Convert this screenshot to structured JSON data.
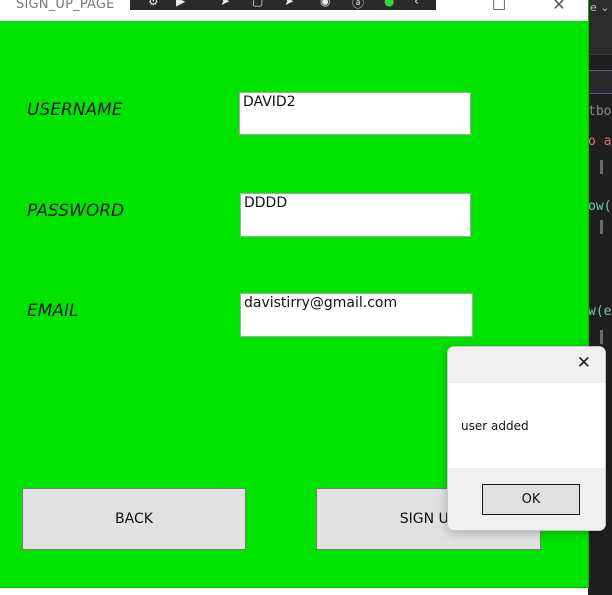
{
  "window": {
    "title": "SIGN_UP_PAGE",
    "minimize_glyph": "—",
    "maximize_glyph": "☐",
    "close_glyph": "✕",
    "background_color": "#00e400"
  },
  "form": {
    "username_label": "USERNAME",
    "username_value": "DAVID2",
    "password_label": "PASSWORD",
    "password_value": "DDDD",
    "email_label": "EMAIL",
    "email_value": "davistirry@gmail.com"
  },
  "buttons": {
    "back": "BACK",
    "sign_up": "SIGN UP"
  },
  "dialog": {
    "close_glyph": "✕",
    "message": "user added",
    "ok_label": "OK"
  },
  "editor_fragments": {
    "tab_text": "e ⌄",
    "line_a": "tbox",
    "line_b": "o a",
    "line_c": "ow(",
    "line_d": "w(e"
  }
}
